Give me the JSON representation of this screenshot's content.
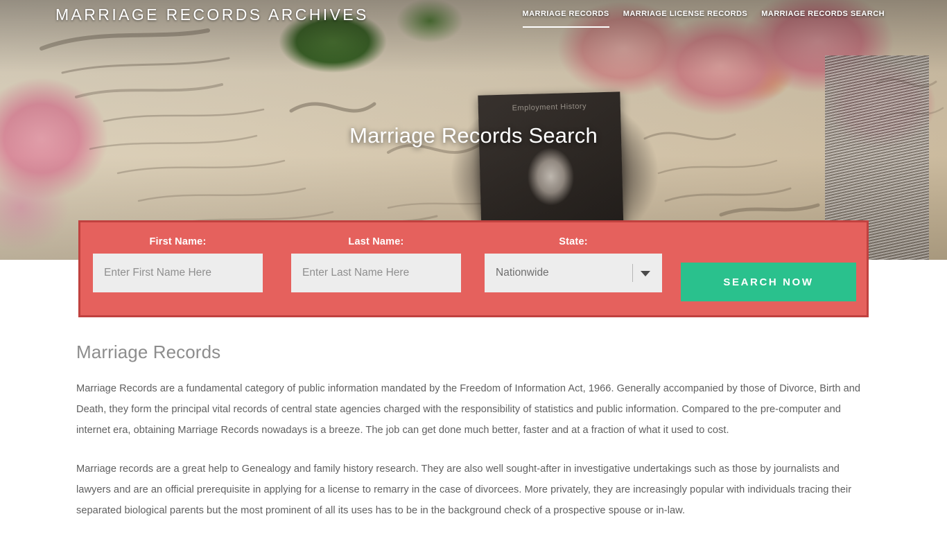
{
  "header": {
    "logo": "MARRIAGE RECORDS ARCHIVES",
    "nav": [
      {
        "label": "MARRIAGE RECORDS",
        "active": true
      },
      {
        "label": "MARRIAGE LICENSE RECORDS",
        "active": false
      },
      {
        "label": "MARRIAGE RECORDS SEARCH",
        "active": false
      }
    ]
  },
  "hero": {
    "title": "Marriage Records Search",
    "card_caption": "Employment History"
  },
  "search_form": {
    "first_name": {
      "label": "First Name:",
      "placeholder": "Enter First Name Here",
      "value": ""
    },
    "last_name": {
      "label": "Last Name:",
      "placeholder": "Enter Last Name Here",
      "value": ""
    },
    "state": {
      "label": "State:",
      "selected": "Nationwide"
    },
    "submit_label": "SEARCH NOW"
  },
  "main": {
    "heading": "Marriage Records",
    "paragraph_1": "Marriage Records are a fundamental category of public information mandated by the Freedom of Information Act, 1966. Generally accompanied by those of Divorce, Birth and Death, they form the principal vital records of central state agencies charged with the responsibility of statistics and public information. Compared to the pre-computer and internet era, obtaining Marriage Records nowadays is a breeze. The job can get done much better, faster and at a fraction of what it used to cost.",
    "paragraph_2": "Marriage records are a great help to Genealogy and family history research. They are also well sought-after in investigative undertakings such as those by journalists and lawyers and are an official prerequisite in applying for a license to remarry in the case of divorcees. More privately, they are increasingly popular with individuals tracing their separated biological parents but the most prominent of all its uses has to be in the background check of a prospective spouse or in-law."
  },
  "colors": {
    "panel_bg": "#e5615d",
    "panel_border": "#c0413f",
    "button_green": "#2ac18d",
    "input_bg": "#ededed",
    "heading_gray": "#8d8d8d",
    "body_gray": "#5e5e5e"
  }
}
